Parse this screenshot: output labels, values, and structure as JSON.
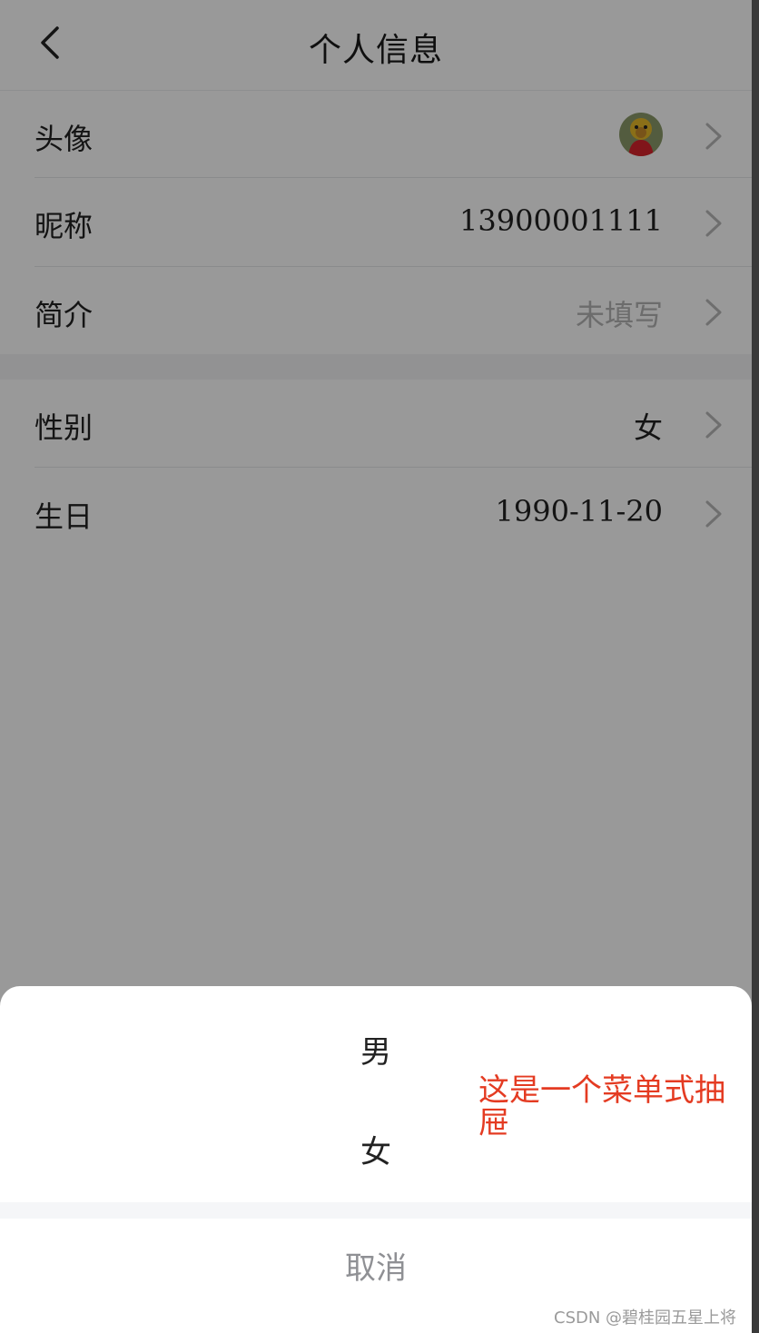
{
  "navbar": {
    "title": "个人信息"
  },
  "profile": {
    "avatar": {
      "label": "头像"
    },
    "nickname": {
      "label": "昵称",
      "value": "13900001111"
    },
    "bio": {
      "label": "简介",
      "placeholder": "未填写"
    },
    "gender": {
      "label": "性别",
      "value": "女"
    },
    "birthday": {
      "label": "生日",
      "value": "1990-11-20"
    }
  },
  "action_sheet": {
    "options": [
      {
        "label": "男"
      },
      {
        "label": "女"
      }
    ],
    "cancel_label": "取消"
  },
  "annotation": {
    "text": "这是一个菜单式抽屉"
  },
  "watermark": {
    "text": "CSDN @碧桂园五星上将"
  },
  "colors": {
    "overlay": "rgba(0,0,0,0.40)",
    "annotation": "#e43b22",
    "placeholder": "#b4b4b4"
  }
}
